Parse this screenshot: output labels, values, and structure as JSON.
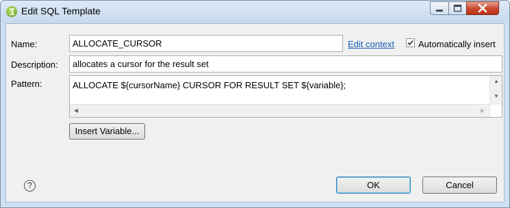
{
  "window": {
    "title": "Edit SQL Template"
  },
  "form": {
    "name_label": "Name:",
    "name_value": "ALLOCATE_CURSOR",
    "edit_context_link": "Edit context",
    "auto_insert_label": "Automatically insert",
    "auto_insert_checked": true,
    "description_label": "Description:",
    "description_value": "allocates a cursor for the result set",
    "pattern_label": "Pattern:",
    "pattern_value": "ALLOCATE ${cursorName} CURSOR FOR RESULT SET ${variable};"
  },
  "buttons": {
    "insert_variable": "Insert Variable...",
    "ok": "OK",
    "cancel": "Cancel",
    "help": "?"
  },
  "icons": {
    "app": "eclipse-app-icon",
    "minimize": "minimize-icon",
    "maximize": "maximize-icon",
    "close": "close-icon",
    "help": "help-icon"
  },
  "colors": {
    "link": "#1a5fb4",
    "close_button": "#c7452c"
  }
}
